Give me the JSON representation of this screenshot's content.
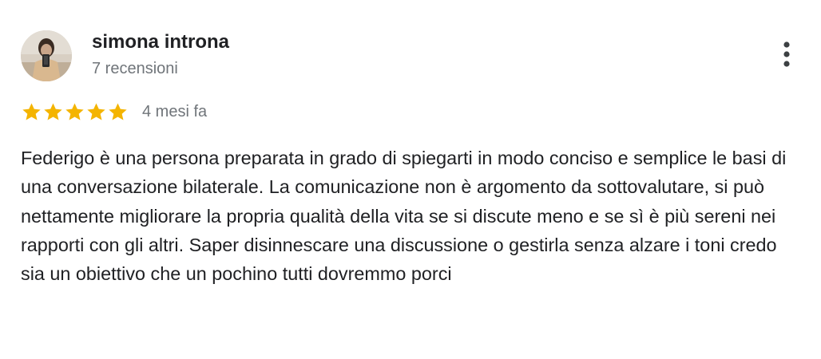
{
  "reviewer": {
    "name": "simona introna",
    "reviews_count": "7 recensioni",
    "avatar_icon": "user-photo-avatar"
  },
  "menu": {
    "icon": "more-vertical-icon"
  },
  "rating": {
    "stars": 5,
    "max_stars": 5,
    "star_color": "#f4b400",
    "date": "4 mesi fa"
  },
  "review": {
    "text": "Federigo è una persona preparata in grado di spiegarti in modo conciso e semplice le basi di una conversazione bilaterale. La comunicazione non è argomento da sottovalutare, si può nettamente migliorare la propria qualità della vita se si discute meno e se sì è più sereni nei rapporti con gli altri. Saper disinnescare una discussione o gestirla senza alzare i toni credo sia un obiettivo che un pochino tutti dovremmo porci"
  },
  "colors": {
    "primary_text": "#202124",
    "secondary_text": "#70757a",
    "star": "#f4b400",
    "menu_dots": "#3c4043"
  }
}
